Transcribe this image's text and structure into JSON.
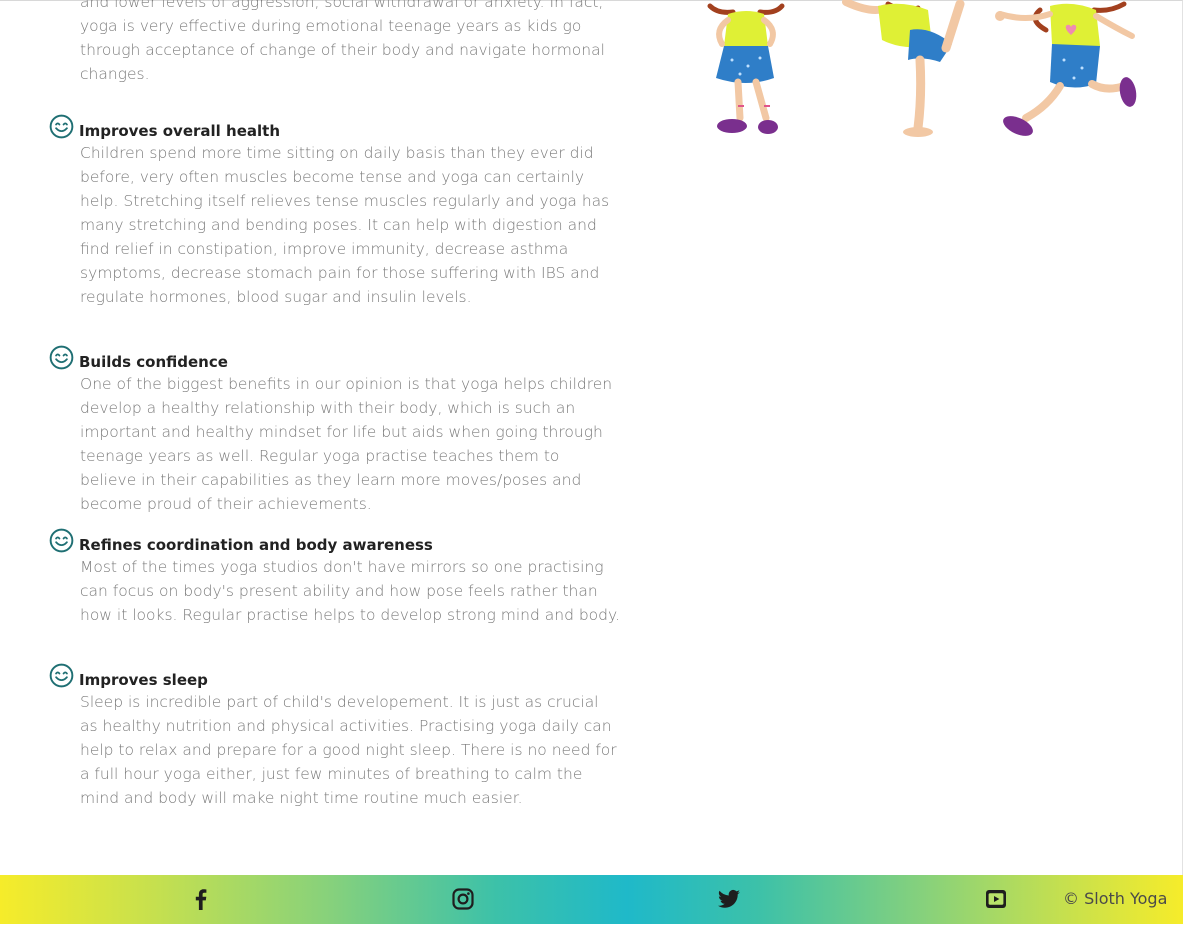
{
  "intro": {
    "text": "and lower levels of aggression, social withdrawal or anxiety. In fact, yoga is very effective during emotional teenage years as kids go through acceptance of change of their body and navigate hormonal changes."
  },
  "benefits": [
    {
      "icon": "smile-icon",
      "title": "Improves overall health",
      "description": "Children spend more time sitting on daily basis than they ever did before, very often muscles become tense and yoga can certainly help. Stretching itself relieves tense muscles regularly and yoga has many stretching and bending poses. It can help with digestion and find relief in constipation, improve immunity, decrease asthma symptoms, decrease stomach pain for those suffering with IBS and regulate hormones, blood sugar and insulin levels."
    },
    {
      "icon": "smile-icon",
      "title": "Builds confidence",
      "description": "One of the biggest benefits in our opinion is that yoga helps children develop a healthy relationship with their body, which is such an important and healthy mindset for life but aids when going through teenage years as well. Regular yoga practise teaches them to believe in their capabilities as they learn more moves/poses and become proud of their achievements."
    },
    {
      "icon": "smile-icon",
      "title": "Refines coordination and body awareness",
      "description": "Most of the times yoga studios don't have mirrors so one practising can focus on body's present ability and how pose feels rather than how it looks. Regular practise helps to develop strong mind and body."
    },
    {
      "icon": "smile-icon",
      "title": "Improves sleep",
      "description": "Sleep is incredible part of child's developement. It is just as crucial as healthy nutrition and physical activities. Practising yoga daily can help to relax and prepare for a good night sleep. There is no need for a full hour yoga either, just few minutes of breathing to calm the mind and body will make night time routine much easier."
    }
  ],
  "footer": {
    "social_icons": [
      "facebook-icon",
      "instagram-icon",
      "twitter-icon",
      "youtube-icon"
    ],
    "copyright": "© Sloth Yoga"
  },
  "colors": {
    "icon_teal": "#1f6f73",
    "gradient_yellow": "#f6ec2a",
    "gradient_teal": "#1fb9c9"
  }
}
